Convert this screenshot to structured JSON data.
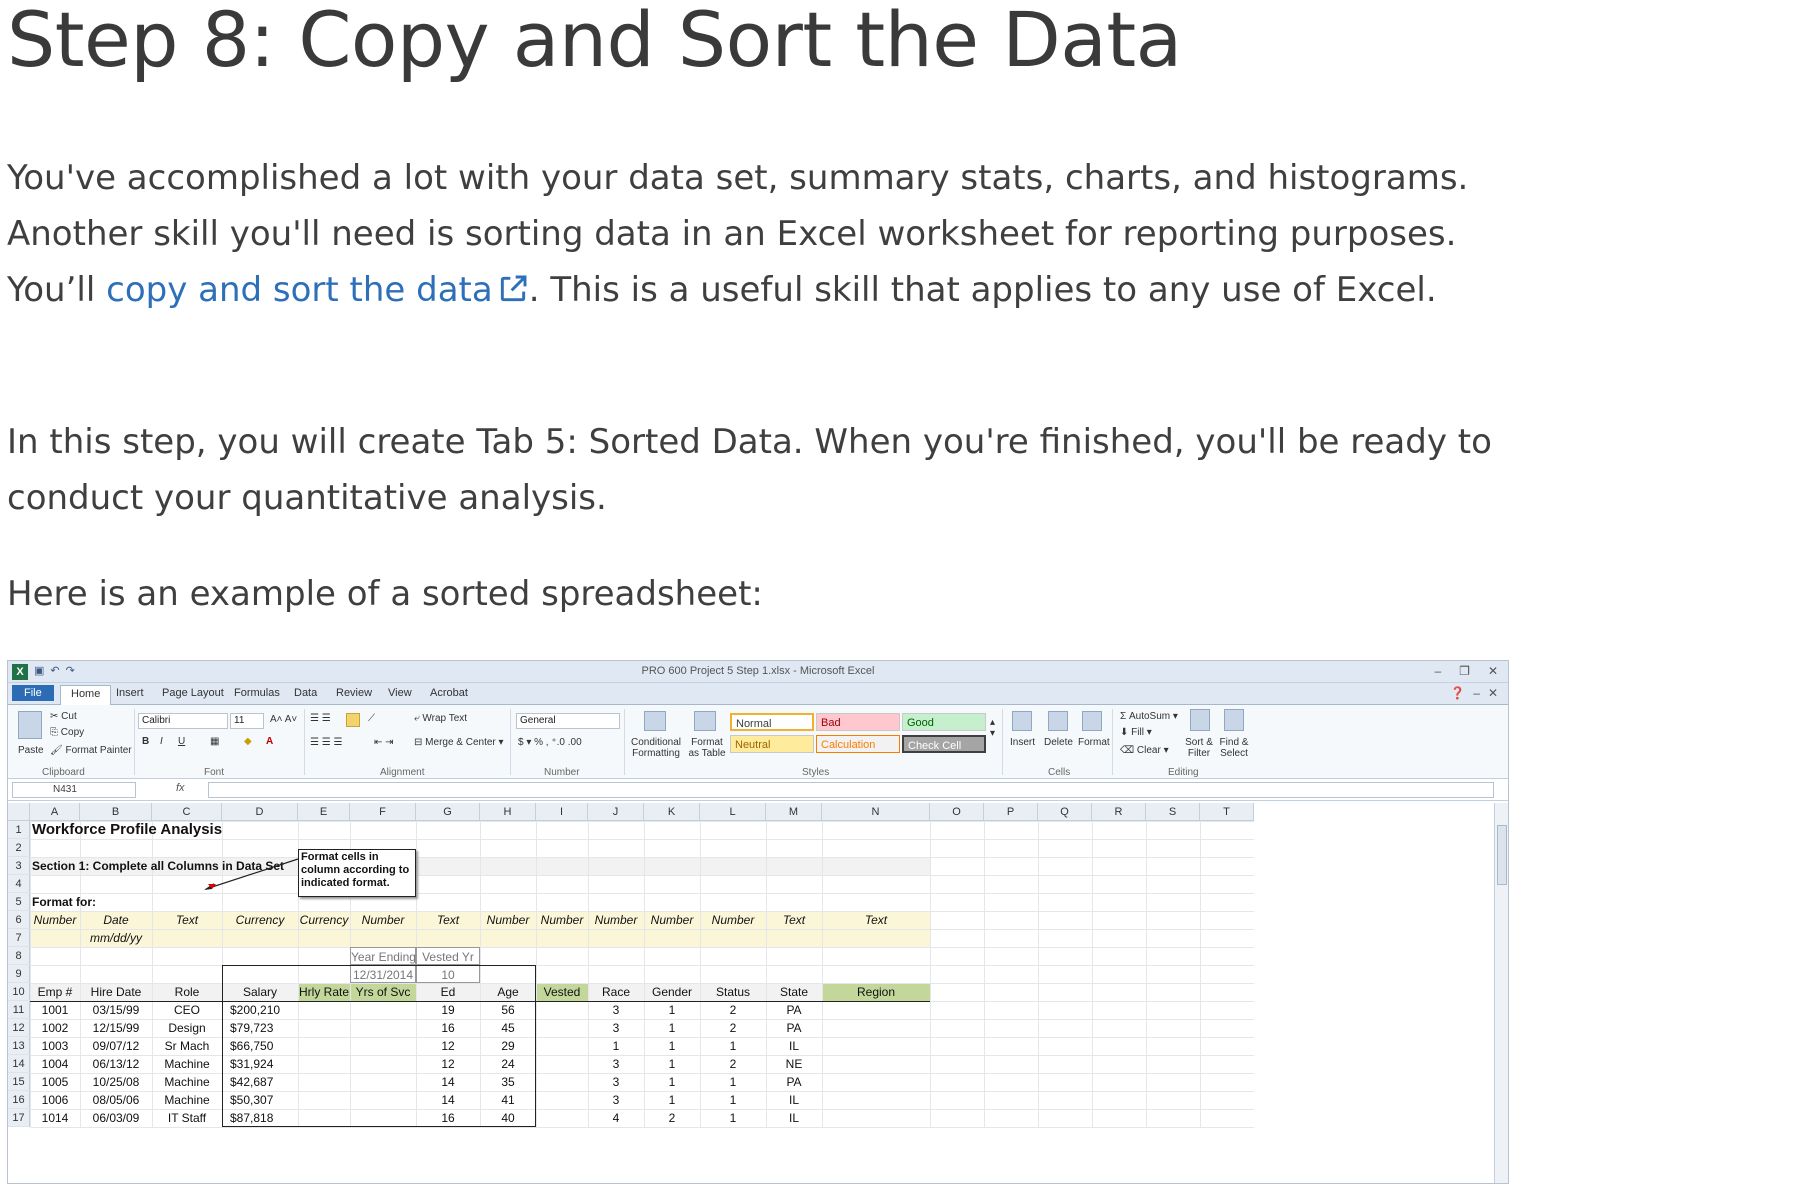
{
  "page": {
    "title": "Step 8: Copy and Sort the Data",
    "p1_before": "You've accomplished a lot with your data set, summary stats, charts, and histograms. Another skill you'll need is sorting data in an Excel worksheet for reporting purposes. You’ll ",
    "p1_link": "copy and sort the data",
    "p1_after": ". This is a useful skill that applies to any use of Excel.",
    "p2": "In this step, you will create Tab 5: Sorted Data. When you're finished, you'll be ready to conduct your quantitative analysis.",
    "p3": "Here is an example of a sorted spreadsheet:",
    "link_color": "#2d6fb9",
    "link_icon": "external-link-icon"
  },
  "excel": {
    "window_title": "PRO 600 Project 5 Step 1.xlsx  -  Microsoft Excel",
    "tabs": [
      "File",
      "Home",
      "Insert",
      "Page Layout",
      "Formulas",
      "Data",
      "Review",
      "View",
      "Acrobat"
    ],
    "active_tab": "Home",
    "ribbon": {
      "clipboard": {
        "cut": "Cut",
        "copy": "Copy",
        "paste": "Paste",
        "format_painter": "Format Painter",
        "label": "Clipboard"
      },
      "font": {
        "name": "Calibri",
        "size": "11",
        "label": "Font"
      },
      "alignment": {
        "wrap_text": "Wrap Text",
        "merge_center": "Merge & Center",
        "label": "Alignment"
      },
      "number": {
        "format": "General",
        "label": "Number"
      },
      "styles": {
        "conditional": "Conditional Formatting",
        "format_table": "Format as Table",
        "normal": "Normal",
        "bad": "Bad",
        "good": "Good",
        "neutral": "Neutral",
        "calculation": "Calculation",
        "check_cell": "Check Cell",
        "label": "Styles"
      },
      "cells": {
        "insert": "Insert",
        "delete": "Delete",
        "format": "Format",
        "label": "Cells"
      },
      "editing": {
        "autosum": "AutoSum",
        "fill": "Fill",
        "clear": "Clear",
        "sort_filter": "Sort & Filter",
        "find_select": "Find & Select",
        "label": "Editing"
      }
    },
    "name_box": "N431",
    "fx": "fx",
    "columns": [
      "A",
      "B",
      "C",
      "D",
      "E",
      "F",
      "G",
      "H",
      "I",
      "J",
      "K",
      "L",
      "M",
      "N",
      "O",
      "P",
      "Q",
      "R",
      "S",
      "T"
    ],
    "rows": [
      "1",
      "2",
      "3",
      "4",
      "5",
      "6",
      "7",
      "8",
      "9",
      "10",
      "11",
      "12",
      "13",
      "14",
      "15",
      "16",
      "17"
    ],
    "sheet_title": "Workforce Profile Analysis",
    "section_label": "Section 1: Complete all Columns in Data Set",
    "callout": "Format cells in column according to indicated format.",
    "format_for": "Format for:",
    "formats": [
      "Number",
      "Date",
      "Text",
      "Currency",
      "Currency",
      "Number",
      "Text",
      "Number",
      "Number",
      "Number",
      "Number",
      "Number",
      "Text",
      "Text"
    ],
    "date_format": "mm/dd/yy",
    "year_ending_label": "Year Ending",
    "year_ending_value": "12/31/2014",
    "vested_yr_label": "Vested Yr",
    "vested_yr_value": "10",
    "headers": [
      "Emp #",
      "Hire Date",
      "Role",
      "Salary",
      "Hrly Rate",
      "Yrs of Svc",
      "Ed",
      "Age",
      "Vested",
      "Race",
      "Gender",
      "Status",
      "State",
      "Region"
    ],
    "data_rows": [
      [
        "1001",
        "03/15/99",
        "CEO",
        "$200,210",
        "",
        "",
        "19",
        "56",
        "",
        "3",
        "1",
        "2",
        "PA",
        ""
      ],
      [
        "1002",
        "12/15/99",
        "Design",
        "$79,723",
        "",
        "",
        "16",
        "45",
        "",
        "3",
        "1",
        "2",
        "PA",
        ""
      ],
      [
        "1003",
        "09/07/12",
        "Sr Mach",
        "$66,750",
        "",
        "",
        "12",
        "29",
        "",
        "1",
        "1",
        "1",
        "IL",
        ""
      ],
      [
        "1004",
        "06/13/12",
        "Machine",
        "$31,924",
        "",
        "",
        "12",
        "24",
        "",
        "3",
        "1",
        "2",
        "NE",
        ""
      ],
      [
        "1005",
        "10/25/08",
        "Machine",
        "$42,687",
        "",
        "",
        "14",
        "35",
        "",
        "3",
        "1",
        "1",
        "PA",
        ""
      ],
      [
        "1006",
        "08/05/06",
        "Machine",
        "$50,307",
        "",
        "",
        "14",
        "41",
        "",
        "3",
        "1",
        "1",
        "IL",
        ""
      ],
      [
        "1014",
        "06/03/09",
        "IT Staff",
        "$87,818",
        "",
        "",
        "16",
        "40",
        "",
        "4",
        "2",
        "1",
        "IL",
        ""
      ]
    ]
  }
}
